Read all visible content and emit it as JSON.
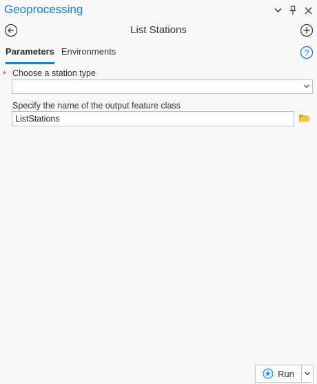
{
  "pane": {
    "title": "Geoprocessing",
    "icons": [
      "chevron-down-icon",
      "pin-icon",
      "close-icon"
    ]
  },
  "tool": {
    "title": "List Stations"
  },
  "tabs": [
    {
      "label": "Parameters",
      "active": true
    },
    {
      "label": "Environments",
      "active": false
    }
  ],
  "params": {
    "station_type": {
      "label": "Choose a station type",
      "required": true,
      "value": ""
    },
    "output": {
      "label": "Specify the name of the output feature class",
      "value": "ListStations"
    }
  },
  "run": {
    "label": "Run"
  },
  "colors": {
    "accent": "#1b7bc4",
    "required": "#d9342b",
    "folder": "#e8b92a"
  }
}
